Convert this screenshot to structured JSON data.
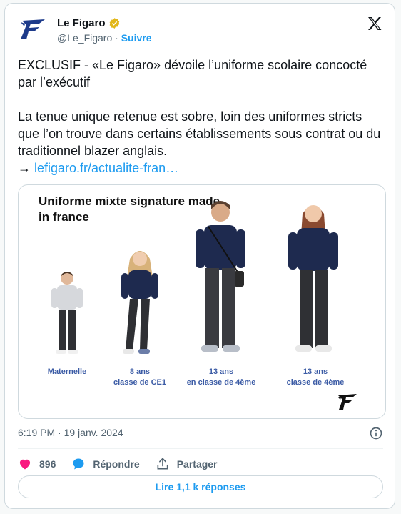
{
  "author": {
    "name": "Le Figaro",
    "handle": "@Le_Figaro",
    "separator": "·",
    "follow_label": "Suivre"
  },
  "tweet": {
    "text": "EXCLUSIF - «Le Figaro» dévoile l’uniforme scolaire concocté par l’exécutif\n\nLa tenue unique retenue est sobre, loin des uniformes stricts que l’on trouve dans certains établissements sous contrat ou du traditionnel blazer anglais.\n→ ",
    "link": "lefigaro.fr/actualite-fran…"
  },
  "media": {
    "title": "Uniforme mixte signature made in france",
    "captions": [
      "Maternelle",
      "8 ans\nclasse de CE1",
      "13 ans\nen classe de 4ème",
      "13 ans\nclasse de 4ème"
    ]
  },
  "meta": {
    "timestamp": "6:19 PM · 19 janv. 2024"
  },
  "actions": {
    "likes": "896",
    "reply_label": "Répondre",
    "share_label": "Partager"
  },
  "read_replies_label": "Lire 1,1 k réponses",
  "colors": {
    "accent": "#1d9bf0",
    "like": "#f91880",
    "caption": "#3b5ba5",
    "navy": "#1e2a4f"
  },
  "icons": [
    "figaro-logo-icon",
    "verified-badge-icon",
    "x-logo-icon",
    "info-icon",
    "heart-icon",
    "reply-icon",
    "share-icon"
  ]
}
